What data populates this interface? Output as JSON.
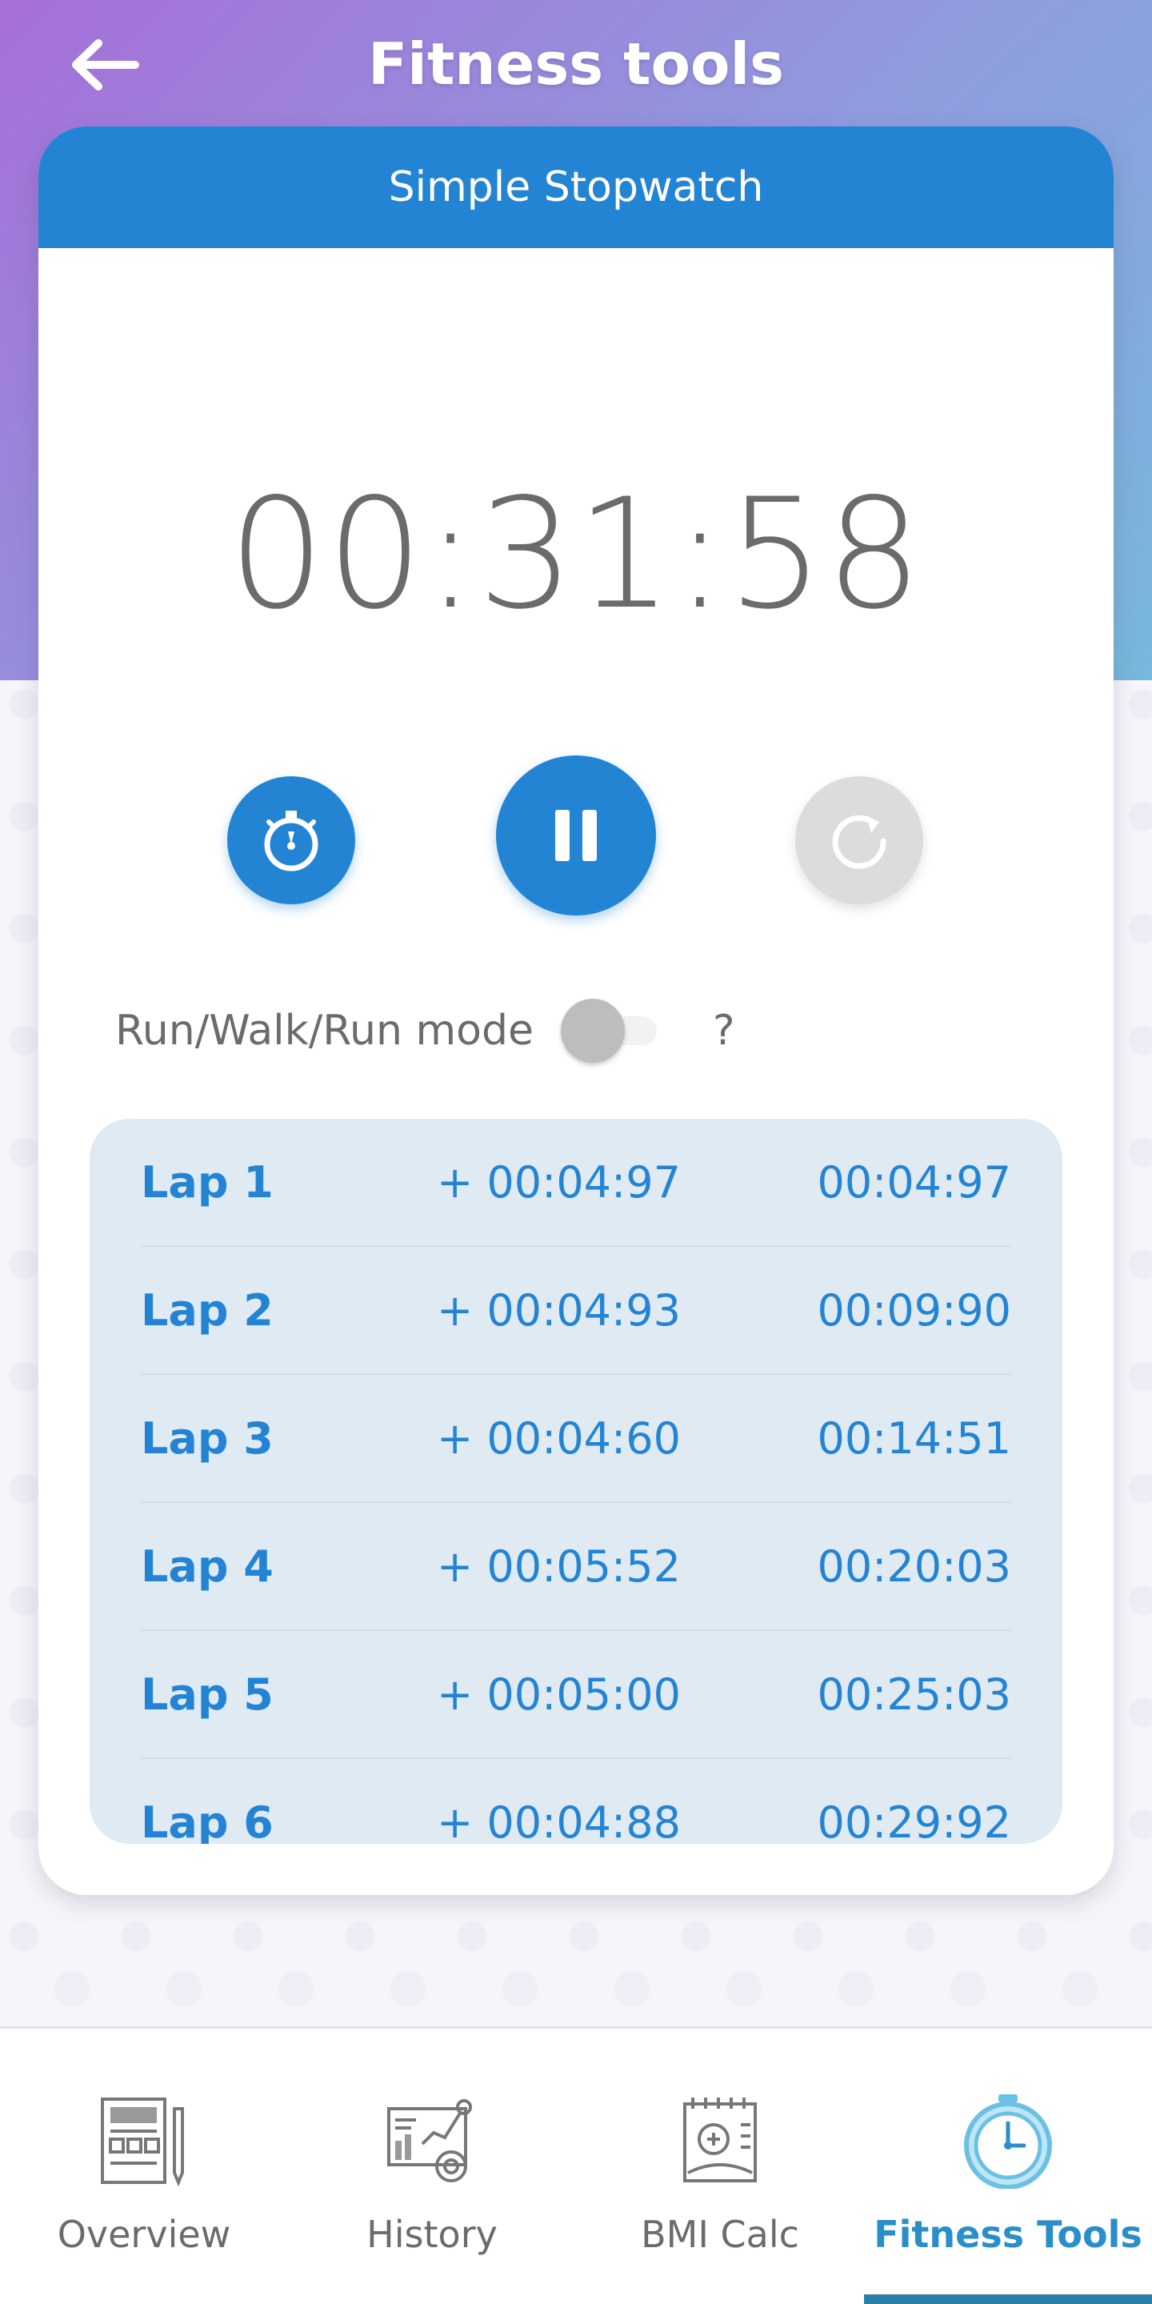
{
  "header": {
    "title": "Fitness tools"
  },
  "card": {
    "title": "Simple Stopwatch"
  },
  "stopwatch": {
    "time": "00:31:58"
  },
  "mode": {
    "label": "Run/Walk/Run mode",
    "enabled": false,
    "help": "?"
  },
  "laps": [
    {
      "name": "Lap 1",
      "split": "+ 00:04:97",
      "total": "00:04:97"
    },
    {
      "name": "Lap 2",
      "split": "+ 00:04:93",
      "total": "00:09:90"
    },
    {
      "name": "Lap 3",
      "split": "+ 00:04:60",
      "total": "00:14:51"
    },
    {
      "name": "Lap 4",
      "split": "+ 00:05:52",
      "total": "00:20:03"
    },
    {
      "name": "Lap 5",
      "split": "+ 00:05:00",
      "total": "00:25:03"
    },
    {
      "name": "Lap 6",
      "split": "+ 00:04:88",
      "total": "00:29:92"
    }
  ],
  "nav": [
    {
      "label": "Overview",
      "icon": "overview-icon"
    },
    {
      "label": "History",
      "icon": "history-icon"
    },
    {
      "label": "BMI Calc",
      "icon": "bmi-calc-icon"
    },
    {
      "label": "Fitness Tools",
      "icon": "stopwatch-icon",
      "active": true
    }
  ],
  "colors": {
    "primary": "#2384d4",
    "header_gradient_start": "#a66fd8",
    "header_gradient_end": "#78b8dc",
    "lap_background": "#e0eaf3",
    "active_nav": "#2a8fc9"
  }
}
